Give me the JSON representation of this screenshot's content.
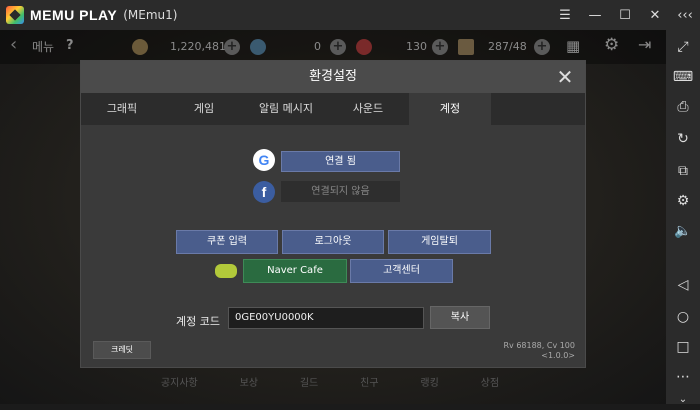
{
  "window": {
    "app_name": "MEMU PLAY",
    "instance": "(MEmu1)",
    "controls": [
      "menu-icon",
      "minimize-icon",
      "maximize-icon",
      "close-icon",
      "collapse-icon"
    ]
  },
  "game_topbar": {
    "menu_label": "메뉴",
    "gold": "1,220,481",
    "gems": "0",
    "stamina": "130",
    "inventory": "287/48"
  },
  "bottom_nav": [
    "공지사항",
    "보상",
    "길드",
    "친구",
    "랭킹",
    "상점"
  ],
  "dialog": {
    "title": "환경설정",
    "tabs": [
      "그래픽",
      "게임",
      "알림 메시지",
      "사운드",
      "계정"
    ],
    "active_tab": "계정",
    "google": {
      "label": "연결 됨"
    },
    "facebook": {
      "label": "연결되지 않음"
    },
    "actions": {
      "coupon": "쿠폰 입력",
      "logout": "로그아웃",
      "withdraw": "게임탈퇴",
      "naver_cafe": "Naver Cafe",
      "support": "고객센터"
    },
    "account_code": {
      "label": "계정 코드",
      "value": "0GE00YU0000K",
      "copy": "복사"
    },
    "credits": "크레딧",
    "version_line1": "Rv 68188, Cv 100",
    "version_line2": "<1.0.0>"
  },
  "colors": {
    "primary_button": "#4a5d8c",
    "naver_button": "#2a6b40",
    "dialog_bg": "#3a3a3a"
  }
}
